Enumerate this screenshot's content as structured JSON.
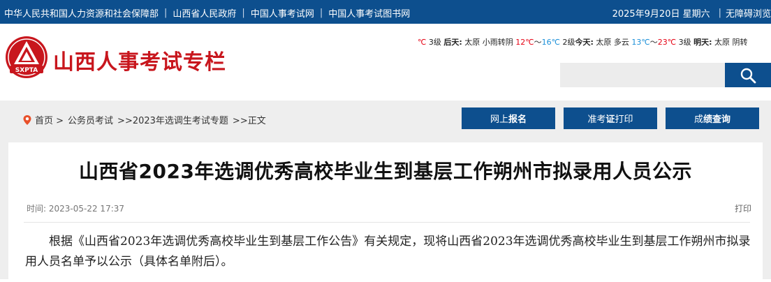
{
  "topbar": {
    "links": [
      "中华人民共和国人力资源和社会保障部",
      "山西省人民政府",
      "中国人事考试网",
      "中国人事考试图书网"
    ],
    "date": "2025年9月20日 星期六",
    "accessibility": "无障碍浏览"
  },
  "header": {
    "logo_text": "SXPTA",
    "site_title": "山西人事考试专栏",
    "weather": {
      "lead_unit": "℃",
      "lead_wind": "3级",
      "day1_label": "后天:",
      "day1_city": "太原",
      "day1_cond": "小雨转阴",
      "day1_high": "12℃",
      "tilde1": "～",
      "day1_low": "16℃",
      "day1_wind": "2级",
      "day2_label": "今天:",
      "day2_city": "太原",
      "day2_cond": "多云",
      "day2_low": "13℃",
      "tilde2": "～",
      "day2_high": "23℃",
      "day2_wind": "3级",
      "day3_label": "明天:",
      "day3_city": "太原",
      "day3_cond": "阴转"
    },
    "search_placeholder": ""
  },
  "breadcrumb": {
    "home": "首页 >",
    "level1": "公务员考试",
    "level2": ">>2023年选调生考试专题",
    "level3": ">>正文"
  },
  "nav": {
    "register_pre": "网上",
    "register_bold": "报名",
    "ticket_pre": "准考",
    "ticket_bold": "证",
    "ticket_post": "打印",
    "score_pre": "成",
    "score_bold": "绩查询"
  },
  "article": {
    "title": "山西省2023年选调优秀高校毕业生到基层工作朔州市拟录用人员公示",
    "time_label": "时间:",
    "time_value": "2023-05-22 17:37",
    "print_label": "打印",
    "paragraph": "根据《山西省2023年选调优秀高校毕业生到基层工作公告》有关规定，现将山西省2023年选调优秀高校毕业生到基层工作朔州市拟录用人员名单予以公示（具体名单附后）。"
  },
  "colors": {
    "brand_blue": "#0d4f8e",
    "brand_red": "#c8161d"
  }
}
